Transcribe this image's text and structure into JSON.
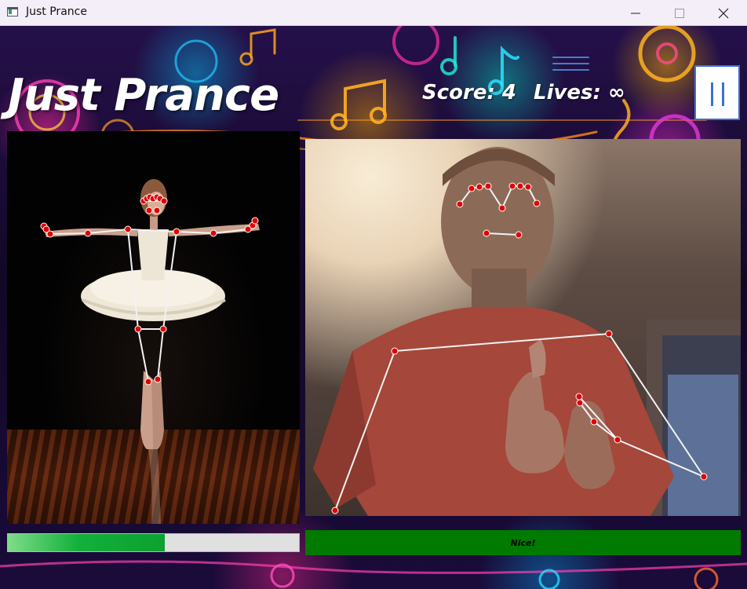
{
  "window": {
    "title": "Just Prance",
    "controls": [
      "minimize",
      "maximize",
      "close"
    ]
  },
  "game": {
    "title": "Just Prance",
    "score_label": "Score: 4",
    "lives_label": "Lives: ∞",
    "pause_icon": "pause-icon"
  },
  "reference_panel": {
    "description_icon": "ballerina-reference-image"
  },
  "camera_panel": {
    "description_icon": "webcam-feed"
  },
  "progress": {
    "fraction": 0.54
  },
  "feedback": {
    "text": "Nice!",
    "color": "#007a00"
  },
  "colors": {
    "keypoint": "#e00000",
    "skeleton": "#f2f2f2",
    "progress": "#0da031",
    "pause_accent": "#3b6fd6"
  }
}
